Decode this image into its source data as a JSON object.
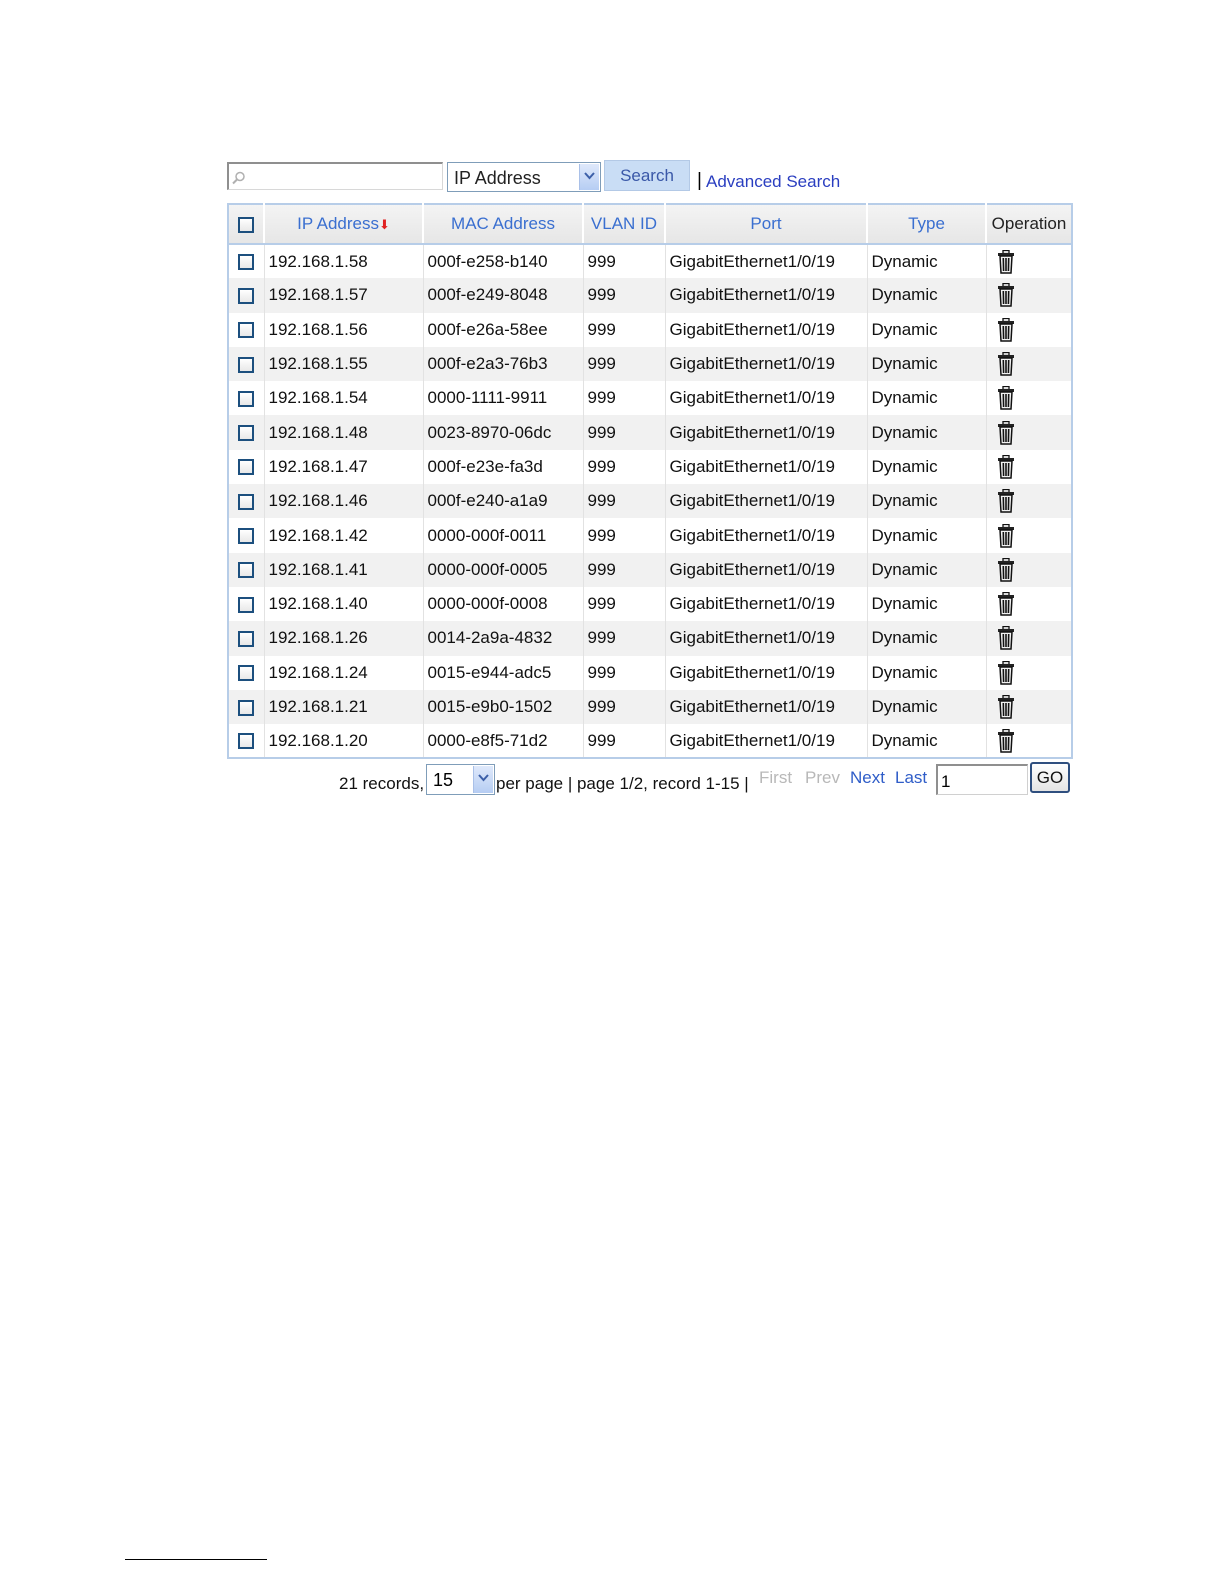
{
  "search": {
    "input_value": "",
    "field_selected": "IP Address",
    "search_button": "Search",
    "separator": "|",
    "advanced_link": "Advanced Search"
  },
  "table": {
    "columns": {
      "ip": "IP Address",
      "sort_indicator": "⬇",
      "mac": "MAC Address",
      "vlan": "VLAN ID",
      "port": "Port",
      "type": "Type",
      "operation": "Operation"
    },
    "rows": [
      {
        "ip": "192.168.1.58",
        "mac": "000f-e258-b140",
        "vlan": "999",
        "port": "GigabitEthernet1/0/19",
        "type": "Dynamic"
      },
      {
        "ip": "192.168.1.57",
        "mac": "000f-e249-8048",
        "vlan": "999",
        "port": "GigabitEthernet1/0/19",
        "type": "Dynamic"
      },
      {
        "ip": "192.168.1.56",
        "mac": "000f-e26a-58ee",
        "vlan": "999",
        "port": "GigabitEthernet1/0/19",
        "type": "Dynamic"
      },
      {
        "ip": "192.168.1.55",
        "mac": "000f-e2a3-76b3",
        "vlan": "999",
        "port": "GigabitEthernet1/0/19",
        "type": "Dynamic"
      },
      {
        "ip": "192.168.1.54",
        "mac": "0000-1111-9911",
        "vlan": "999",
        "port": "GigabitEthernet1/0/19",
        "type": "Dynamic"
      },
      {
        "ip": "192.168.1.48",
        "mac": "0023-8970-06dc",
        "vlan": "999",
        "port": "GigabitEthernet1/0/19",
        "type": "Dynamic"
      },
      {
        "ip": "192.168.1.47",
        "mac": "000f-e23e-fa3d",
        "vlan": "999",
        "port": "GigabitEthernet1/0/19",
        "type": "Dynamic"
      },
      {
        "ip": "192.168.1.46",
        "mac": "000f-e240-a1a9",
        "vlan": "999",
        "port": "GigabitEthernet1/0/19",
        "type": "Dynamic"
      },
      {
        "ip": "192.168.1.42",
        "mac": "0000-000f-0011",
        "vlan": "999",
        "port": "GigabitEthernet1/0/19",
        "type": "Dynamic"
      },
      {
        "ip": "192.168.1.41",
        "mac": "0000-000f-0005",
        "vlan": "999",
        "port": "GigabitEthernet1/0/19",
        "type": "Dynamic"
      },
      {
        "ip": "192.168.1.40",
        "mac": "0000-000f-0008",
        "vlan": "999",
        "port": "GigabitEthernet1/0/19",
        "type": "Dynamic"
      },
      {
        "ip": "192.168.1.26",
        "mac": "0014-2a9a-4832",
        "vlan": "999",
        "port": "GigabitEthernet1/0/19",
        "type": "Dynamic"
      },
      {
        "ip": "192.168.1.24",
        "mac": "0015-e944-adc5",
        "vlan": "999",
        "port": "GigabitEthernet1/0/19",
        "type": "Dynamic"
      },
      {
        "ip": "192.168.1.21",
        "mac": "0015-e9b0-1502",
        "vlan": "999",
        "port": "GigabitEthernet1/0/19",
        "type": "Dynamic"
      },
      {
        "ip": "192.168.1.20",
        "mac": "0000-e8f5-71d2",
        "vlan": "999",
        "port": "GigabitEthernet1/0/19",
        "type": "Dynamic"
      }
    ],
    "icons": {
      "row_action": "trash-icon",
      "checkbox": "checkbox-icon"
    }
  },
  "pagination": {
    "records": "21 records,",
    "per_page_selected": "15",
    "page_info": "per page | page 1/2, record 1-15 |",
    "first": "First",
    "prev": "Prev",
    "next": "Next",
    "last": "Last",
    "page_input_value": "1",
    "go": "GO"
  },
  "colors": {
    "link": "#2a3ec0",
    "header_text": "#3a6fd0",
    "table_border": "#b7cde8",
    "disabled": "#b8b8b8",
    "sort_arrow": "#e02020"
  }
}
